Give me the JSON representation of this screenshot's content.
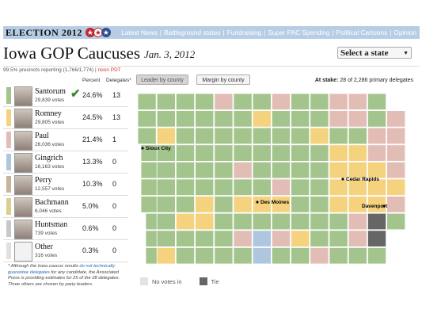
{
  "header": {
    "brand": "ELECTION 2012",
    "nav": [
      "Latest News",
      "Battleground states",
      "Fundraising",
      "Super PAC Spending",
      "Political Cartoons",
      "Opinion"
    ]
  },
  "title": "Iowa GOP Caucuses",
  "date": "Jan. 3, 2012",
  "state_select": {
    "value": "Select a state"
  },
  "precincts": {
    "text": "99.5% precincts reporting (1,766/1,774)",
    "time": "noon PDT"
  },
  "columns": {
    "percent": "Percent",
    "delegates": "Delegates*"
  },
  "candidates": [
    {
      "name": "Santorum",
      "votes": "29,839 votes",
      "percent": "24.6%",
      "delegates": "13",
      "color": "#a3c48c",
      "leader": true
    },
    {
      "name": "Romney",
      "votes": "29,805 votes",
      "percent": "24.5%",
      "delegates": "13",
      "color": "#f4d27e"
    },
    {
      "name": "Paul",
      "votes": "26,036 votes",
      "percent": "21.4%",
      "delegates": "1",
      "color": "#e2bdb6"
    },
    {
      "name": "Gingrich",
      "votes": "16,163 votes",
      "percent": "13.3%",
      "delegates": "0",
      "color": "#aec7de"
    },
    {
      "name": "Perry",
      "votes": "12,557 votes",
      "percent": "10.3%",
      "delegates": "0",
      "color": "#c9b39a"
    },
    {
      "name": "Bachmann",
      "votes": "6,046 votes",
      "percent": "5.0%",
      "delegates": "0",
      "color": "#d8d08c"
    },
    {
      "name": "Huntsman",
      "votes": "739 votes",
      "percent": "0.6%",
      "delegates": "0",
      "color": "#c8c8c8"
    },
    {
      "name": "Other",
      "votes": "316 votes",
      "percent": "0.3%",
      "delegates": "0",
      "color": "#e0e0e0"
    }
  ],
  "footnote": {
    "pre": "* Although the Iowa caucus results ",
    "link": "do not technically guarantee delegates",
    "post": " for any candidate, the Associated Press is providing estimates for 25 of the 28 delegates. Three others are chosen by party leaders."
  },
  "map_buttons": {
    "leader": "Leader by county",
    "margin": "Margin by county"
  },
  "at_stake": {
    "label": "At stake:",
    "text": "28 of 2,286 primary delegates"
  },
  "cities": [
    "Sioux City",
    "Cedar Rapids",
    "Des Moines",
    "Davenport"
  ],
  "legend": {
    "no_votes": "No votes in",
    "tie": "Tie"
  },
  "colors": {
    "santorum": "#a3c48c",
    "romney": "#f4d27e",
    "paul": "#e2bdb6",
    "gingrich": "#aec7de",
    "tie": "#666666",
    "no_votes": "#e6e2df",
    "topbar": "#b7cde5"
  }
}
